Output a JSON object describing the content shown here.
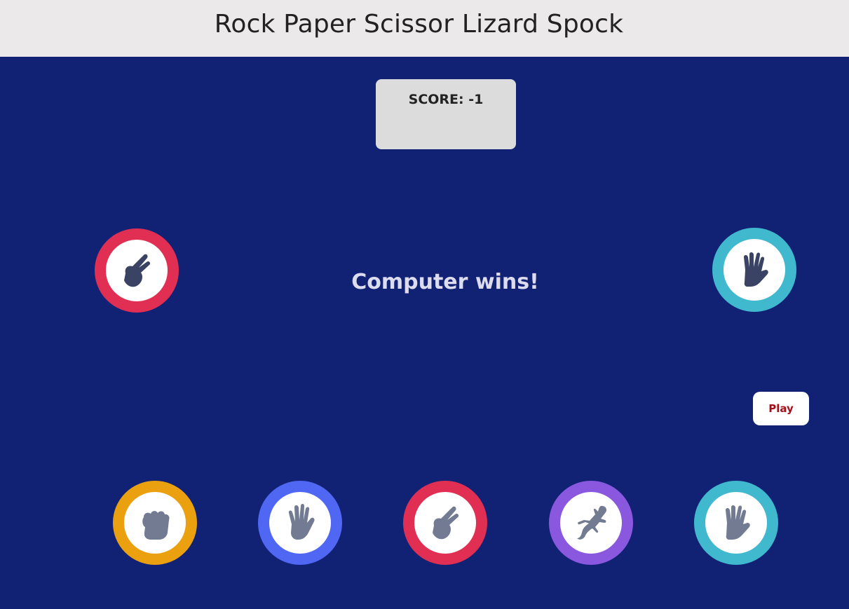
{
  "header": {
    "title": "Rock Paper Scissor Lizard Spock"
  },
  "scoreboard": {
    "score_text": "SCORE: -1"
  },
  "result": {
    "message": "Computer wins!"
  },
  "controls": {
    "play_label": "Play"
  },
  "player_pick": {
    "choice": "scissors",
    "icon": "scissors-hand-icon",
    "ring_color": "#e12f53"
  },
  "computer_pick": {
    "choice": "spock",
    "icon": "spock-hand-icon",
    "ring_color": "#40b8ce"
  },
  "choices": [
    {
      "name": "rock",
      "icon": "rock-fist-icon",
      "ring_color": "#eaa00f"
    },
    {
      "name": "paper",
      "icon": "paper-hand-icon",
      "ring_color": "#4f67f3"
    },
    {
      "name": "scissors",
      "icon": "scissors-hand-icon",
      "ring_color": "#e12f53"
    },
    {
      "name": "lizard",
      "icon": "lizard-icon",
      "ring_color": "#8a57df"
    },
    {
      "name": "spock",
      "icon": "spock-hand-icon",
      "ring_color": "#40b8ce"
    }
  ],
  "colors": {
    "background": "#112275",
    "header_background": "#ebe9e9",
    "play_text": "#a4101a"
  }
}
